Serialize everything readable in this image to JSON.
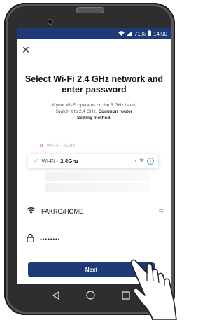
{
  "status_bar": {
    "battery": "71%",
    "time": "14:00"
  },
  "title": "Select Wi-Fi 2.4 GHz network and enter password",
  "subtitle": {
    "line1": "If your Wi-Fi operates on the 5 GHz band,",
    "line2_prefix": "Switch it to 2.4 GHz.",
    "line2_bold": "Common router",
    "line3_bold": "Setting method."
  },
  "networks": {
    "five_ghz_prefix": "Wi-Fi -",
    "five_ghz_band": "5Ghz",
    "two_ghz_prefix": "Wi-Fi -",
    "two_ghz_band": "2.4Ghz"
  },
  "wifi_field": {
    "value": "FAKRO/HOME"
  },
  "password_field": {
    "value": "••••••••"
  },
  "next_button": {
    "label": "Next"
  },
  "colors": {
    "brand": "#1c3b78",
    "phone_body": "#2e2e2e",
    "check": "#2eb36a",
    "cross": "#e23b3b",
    "info": "#4a90e2"
  }
}
